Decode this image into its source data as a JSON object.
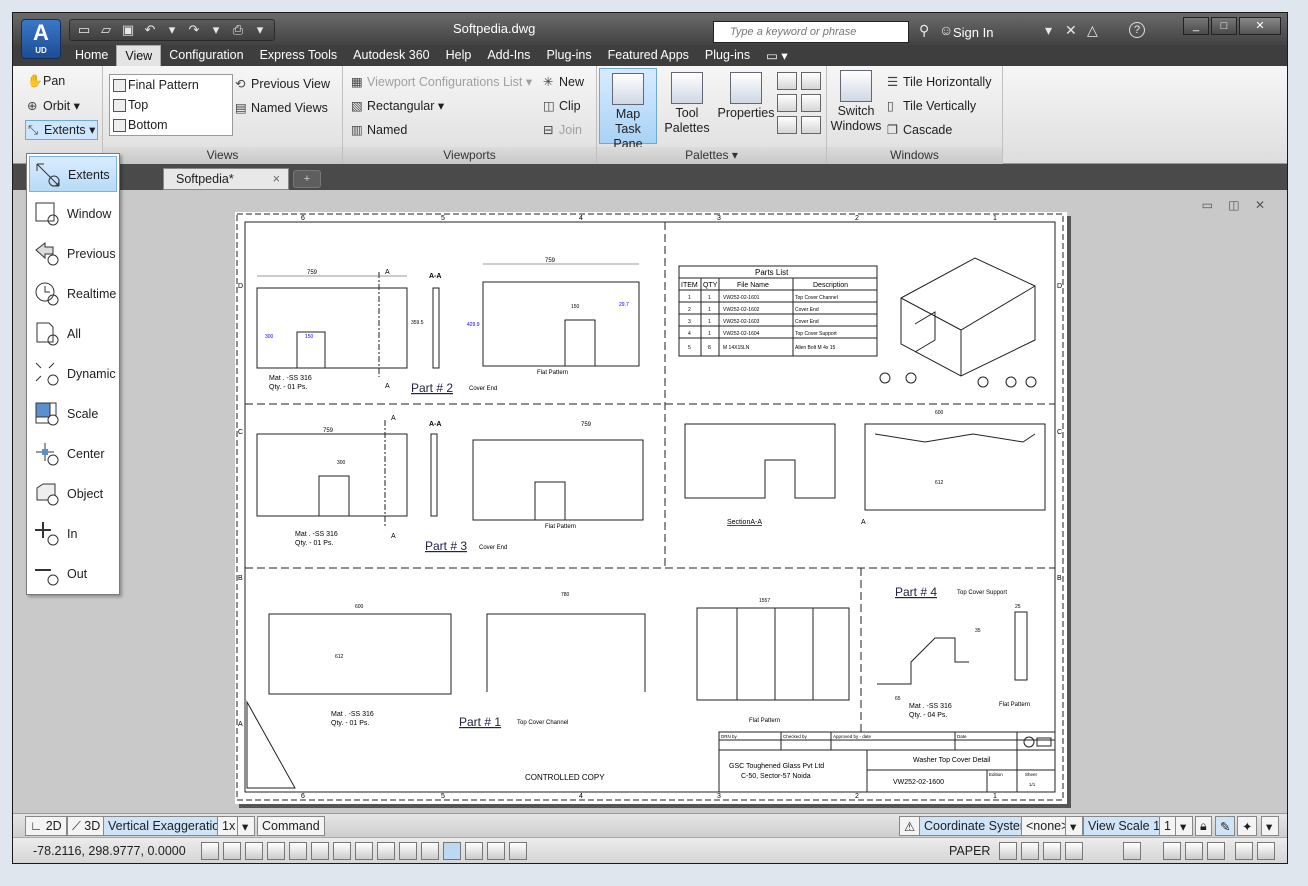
{
  "app": {
    "badge_letter": "A",
    "badge_sub": "UD",
    "window_title": "Softpedia.dwg",
    "search_placeholder": "Type a keyword or phrase",
    "sign_in": "Sign In",
    "help": "?"
  },
  "ribbon_tabs": [
    "Home",
    "View",
    "Configuration",
    "Express Tools",
    "Autodesk 360",
    "Help",
    "Add-Ins",
    "Plug-ins",
    "Featured Apps",
    "Plug-ins"
  ],
  "active_tab": "View",
  "navigate": {
    "pan": "Pan",
    "orbit": "Orbit",
    "extents": "Extents"
  },
  "views": {
    "list": [
      "Final Pattern",
      "Top",
      "Bottom"
    ],
    "previous": "Previous View",
    "named": "Named Views",
    "title": "Views"
  },
  "viewports": {
    "config_list": "Viewport Configurations List",
    "rectangular": "Rectangular",
    "named": "Named",
    "new": "New",
    "clip": "Clip",
    "join": "Join",
    "title": "Viewports"
  },
  "palettes": {
    "map": [
      "Map",
      "Task Pane"
    ],
    "tool": [
      "Tool",
      "Palettes"
    ],
    "properties": "Properties",
    "title": "Palettes"
  },
  "windows": {
    "switch": [
      "Switch",
      "Windows"
    ],
    "tile_h": "Tile Horizontally",
    "tile_v": "Tile Vertically",
    "cascade": "Cascade",
    "title": "Windows"
  },
  "doc_tab": {
    "label": "Softpedia*",
    "close": "×"
  },
  "zoom_menu": [
    "Extents",
    "Window",
    "Previous",
    "Realtime",
    "All",
    "Dynamic",
    "Scale",
    "Center",
    "Object",
    "In",
    "Out"
  ],
  "drawing": {
    "border_top_cols": [
      "6",
      "5",
      "4",
      "3",
      "2",
      "1"
    ],
    "border_rows": [
      "D",
      "C",
      "B",
      "A"
    ],
    "parts_list_title": "Parts List",
    "parts_headers": [
      "ITEM",
      "QTY",
      "File Name",
      "Description"
    ],
    "parts_rows": [
      [
        "1",
        "1",
        "VW252-02-1601",
        "Top Cover Channel"
      ],
      [
        "2",
        "1",
        "VW252-02-1602",
        "Cover End"
      ],
      [
        "3",
        "1",
        "VW252-02-1603",
        "Cover End"
      ],
      [
        "4",
        "1",
        "VW252-02-1604",
        "Top Cover Support"
      ],
      [
        "5",
        "8",
        "M 14X15LN",
        "Allen Bolt M 4x 15"
      ]
    ],
    "part2": "Part # 2",
    "part2_sub": "Cover End",
    "part3": "Part # 3",
    "part3_sub": "Cover End",
    "part1": "Part # 1",
    "part1_sub": "Top Cover Channel",
    "part4": "Part # 4",
    "part4_sub": "Top Cover Support",
    "mat1": "Mat . -SS 316",
    "qty1": "Qty. - 01 Ps.",
    "qty4": "Qty. - 04 Ps.",
    "flat_pattern": "Flat Pattern",
    "section": "SectionA-A",
    "section_aa": "A-A",
    "controlled": "CONTROLLED COPY",
    "company": "GSC Toughened Glass Pvt Ltd",
    "address": "C-50, Sector-57 Noida",
    "drawing_title": "Washer Top Cover Detail",
    "drawing_no": "VW252-02-1600",
    "tb_drn": "DRN by",
    "tb_chk": "Checked by",
    "tb_apr": "Approved by - date",
    "tb_date": "Date",
    "tb_edition": "Edition",
    "tb_sheet": "Sheet",
    "tb_sheet_no": "1/1",
    "dims": {
      "d1": "759",
      "d2": "359.5",
      "d3": "300",
      "d4": "150",
      "d5": "220",
      "d6": "759",
      "d7": "429.9",
      "d8": "150",
      "d9": "29.7",
      "d10": "600",
      "d11": "612",
      "d12": "780",
      "d13": "1557",
      "d14": "65",
      "d15": "35",
      "d16": "25"
    }
  },
  "status_top": {
    "mode2d": "2D",
    "mode3d": "3D",
    "vert_exag_label": "Vertical Exaggeration:",
    "vert_exag_value": "1x",
    "command": "Command",
    "coord_label": "Coordinate System:",
    "coord_value": "<none>",
    "view_scale_label": "View Scale",
    "view_scale_value": "1:",
    "view_scale_num": "1"
  },
  "status_bottom": {
    "coords": "-78.2116,  298.9777, 0.0000",
    "paper": "PAPER"
  }
}
